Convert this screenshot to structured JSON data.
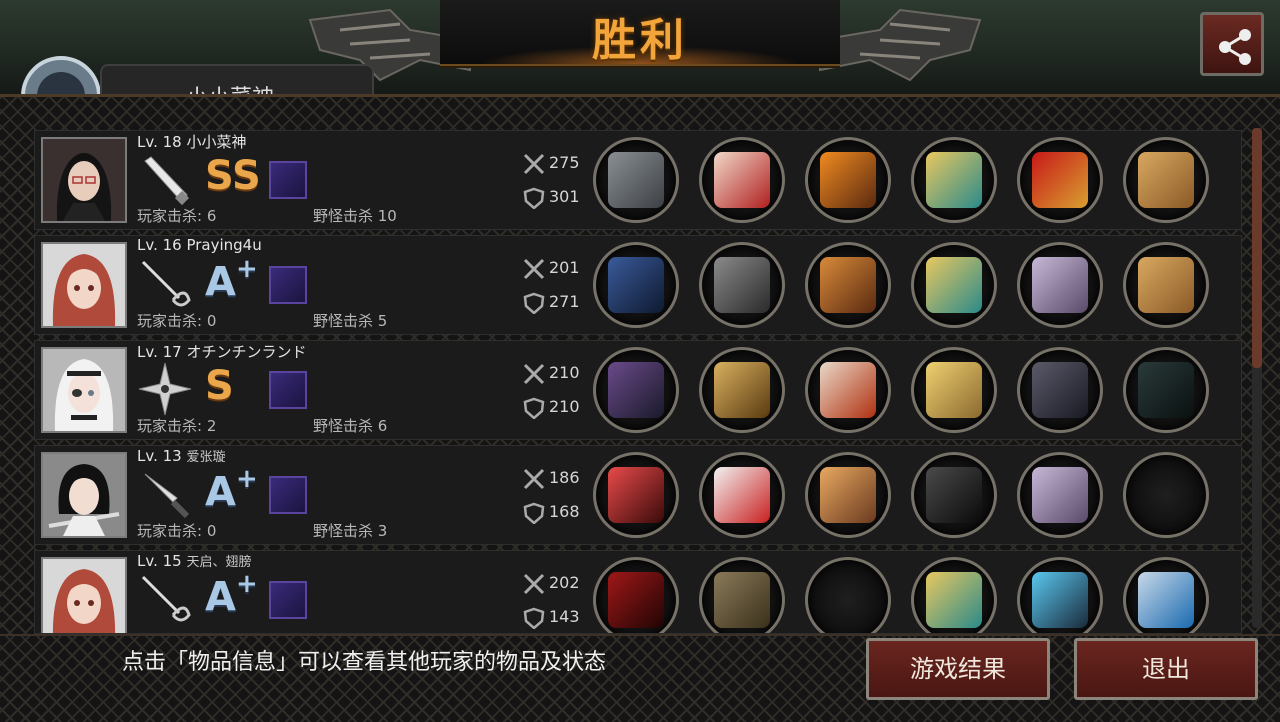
{
  "header": {
    "title": "胜利",
    "player_name_partial": "小小菜神"
  },
  "players": [
    {
      "level": "Lv. 18 小小菜神",
      "weapon_icon": "bat-icon",
      "grade": "SS",
      "player_kills": "玩家击杀: 6",
      "monster_kills": "野怪击杀 10",
      "attack": "275",
      "defense": "301",
      "items": [
        "chainsaw-sword-icon",
        "winged-tiara-icon",
        "flaming-armor-icon",
        "gold-bracelet-icon",
        "red-heels-icon",
        "cat-box-icon"
      ]
    },
    {
      "level": "Lv. 16 Praying4u",
      "weapon_icon": "rapier-icon",
      "grade": "A",
      "grade_plus": "+",
      "player_kills": "玩家击杀: 0",
      "monster_kills": "野怪击杀 5",
      "attack": "201",
      "defense": "271",
      "items": [
        "trident-spear-icon",
        "knight-helmet-icon",
        "bronze-armor-icon",
        "gold-bracelet-icon",
        "purple-boots-icon",
        "cat-box-icon"
      ]
    },
    {
      "level": "Lv. 17 オチンチンランド",
      "weapon_icon": "shuriken-icon",
      "grade": "S",
      "player_kills": "玩家击杀: 2",
      "monster_kills": "野怪击杀 6",
      "attack": "210",
      "defense": "210",
      "items": [
        "boomerang-icon",
        "gold-helmet-icon",
        "fur-armor-icon",
        "gold-shield-icon",
        "dark-gauntlet-icon",
        "scope-icon"
      ]
    },
    {
      "level": "Lv. 13 ",
      "level_name_small": "爱张璇",
      "weapon_icon": "knife-icon",
      "grade": "A",
      "grade_plus": "+",
      "player_kills": "玩家击杀: 0",
      "monster_kills": "野怪击杀 3",
      "attack": "186",
      "defense": "168",
      "items": [
        "red-sword-icon",
        "motocross-helmet-icon",
        "grape-gloves-icon",
        "black-bracer-icon",
        "purple-boots-icon",
        "empty-slot"
      ]
    },
    {
      "level": "Lv. 15 ",
      "level_name_small": "天启、翅膀",
      "weapon_icon": "rapier-icon",
      "grade": "A",
      "grade_plus": "+",
      "player_kills": "",
      "monster_kills": "",
      "attack": "202",
      "defense": "143",
      "items": [
        "crimson-spear-icon",
        "army-helmet-icon",
        "empty-slot",
        "gold-bracelet-icon",
        "blue-sneakers-icon",
        "blue-gem-ring-icon"
      ]
    }
  ],
  "footer": {
    "hint": "点击「物品信息」可以查看其他玩家的物品及状态",
    "result_button": "游戏结果",
    "exit_button": "退出"
  },
  "colors": {
    "title": "#f2a53a",
    "button_bg": "#5a1e18",
    "grade_s": "#e9a64a",
    "grade_a": "#a9c8e6"
  }
}
